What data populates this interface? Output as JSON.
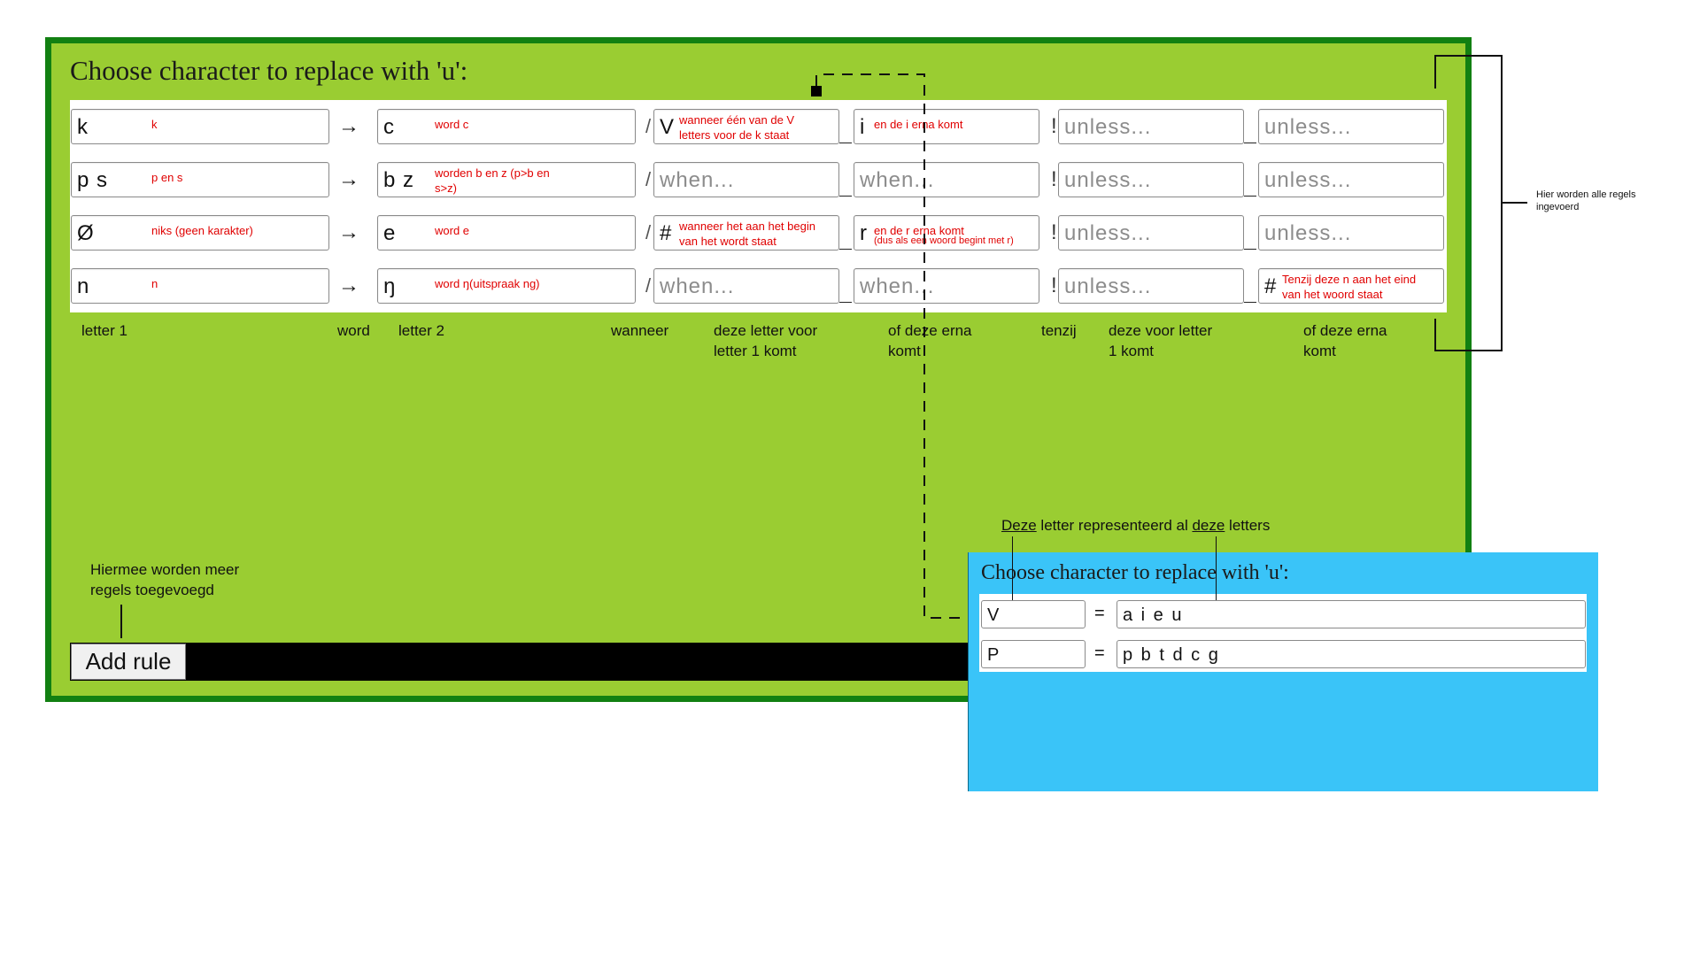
{
  "main": {
    "title": "Choose character to replace with 'u':",
    "arrow": "→",
    "slash": "/",
    "bang": "!",
    "rules": [
      {
        "letter1": "k",
        "letter1_note": "k",
        "letter2": "c",
        "letter2_note": "word c",
        "when_before": "V",
        "when_before_note": "wanneer één van de V\nletters voor de k staat",
        "when_after": "i",
        "when_after_note": "en de i erna komt",
        "unless_before": "unless...",
        "unless_after": "unless..."
      },
      {
        "letter1": "p s",
        "letter1_note": "p en s",
        "letter2": "b z",
        "letter2_note": "worden b en z (p>b en\ns>z)",
        "when_before": "when...",
        "when_before_note": "",
        "when_after": "when...",
        "when_after_note": "",
        "unless_before": "unless...",
        "unless_after": "unless..."
      },
      {
        "letter1": "Ø",
        "letter1_note": "niks (geen karakter)",
        "letter2": "e",
        "letter2_note": "word e",
        "when_before": "#",
        "when_before_note": "wanneer het aan het begin\nvan het wordt staat",
        "when_after": "r",
        "when_after_note": "en de r erna komt",
        "when_after_note2": "(dus als een woord begint met r)",
        "unless_before": "unless...",
        "unless_after": "unless..."
      },
      {
        "letter1": "n",
        "letter1_note": "n",
        "letter2": "ŋ",
        "letter2_note": "word ŋ(uitspraak ng)",
        "when_before": "when...",
        "when_before_note": "",
        "when_after": "when...",
        "when_after_note": "",
        "unless_before": "unless...",
        "unless_after": "#",
        "unless_after_note": "Tenzij deze n aan het eind\nvan het woord staat"
      }
    ],
    "column_labels": {
      "letter1": "letter 1",
      "word": "word",
      "letter2": "letter 2",
      "wanneer": "wanneer",
      "before": "deze letter voor\nletter 1 komt",
      "after": "of deze erna\nkomt",
      "tenzij": "tenzij",
      "unless_before": "deze voor letter\n1 komt",
      "unless_after": "of deze erna\nkomt"
    },
    "add_rule_label": "Add rule"
  },
  "annotations": {
    "rules_entered": "Hier worden alle regels\ningevoerd",
    "add_more_rules": "Hiermee worden meer\nregels toegevoegd",
    "represent_word1": "Deze",
    "represent_mid": " letter representeerd al ",
    "represent_word2": "deze",
    "represent_end": " letters"
  },
  "groups_panel": {
    "title": "Choose character to replace with 'u':",
    "equals": "=",
    "groups": [
      {
        "symbol": "V",
        "letters": "a i e u"
      },
      {
        "symbol": "P",
        "letters": "p b t d c g"
      }
    ]
  },
  "colors": {
    "main_bg": "#9acd32",
    "main_border": "#128012",
    "blue_bg": "#3ac4f8",
    "note_red": "#e00000"
  }
}
